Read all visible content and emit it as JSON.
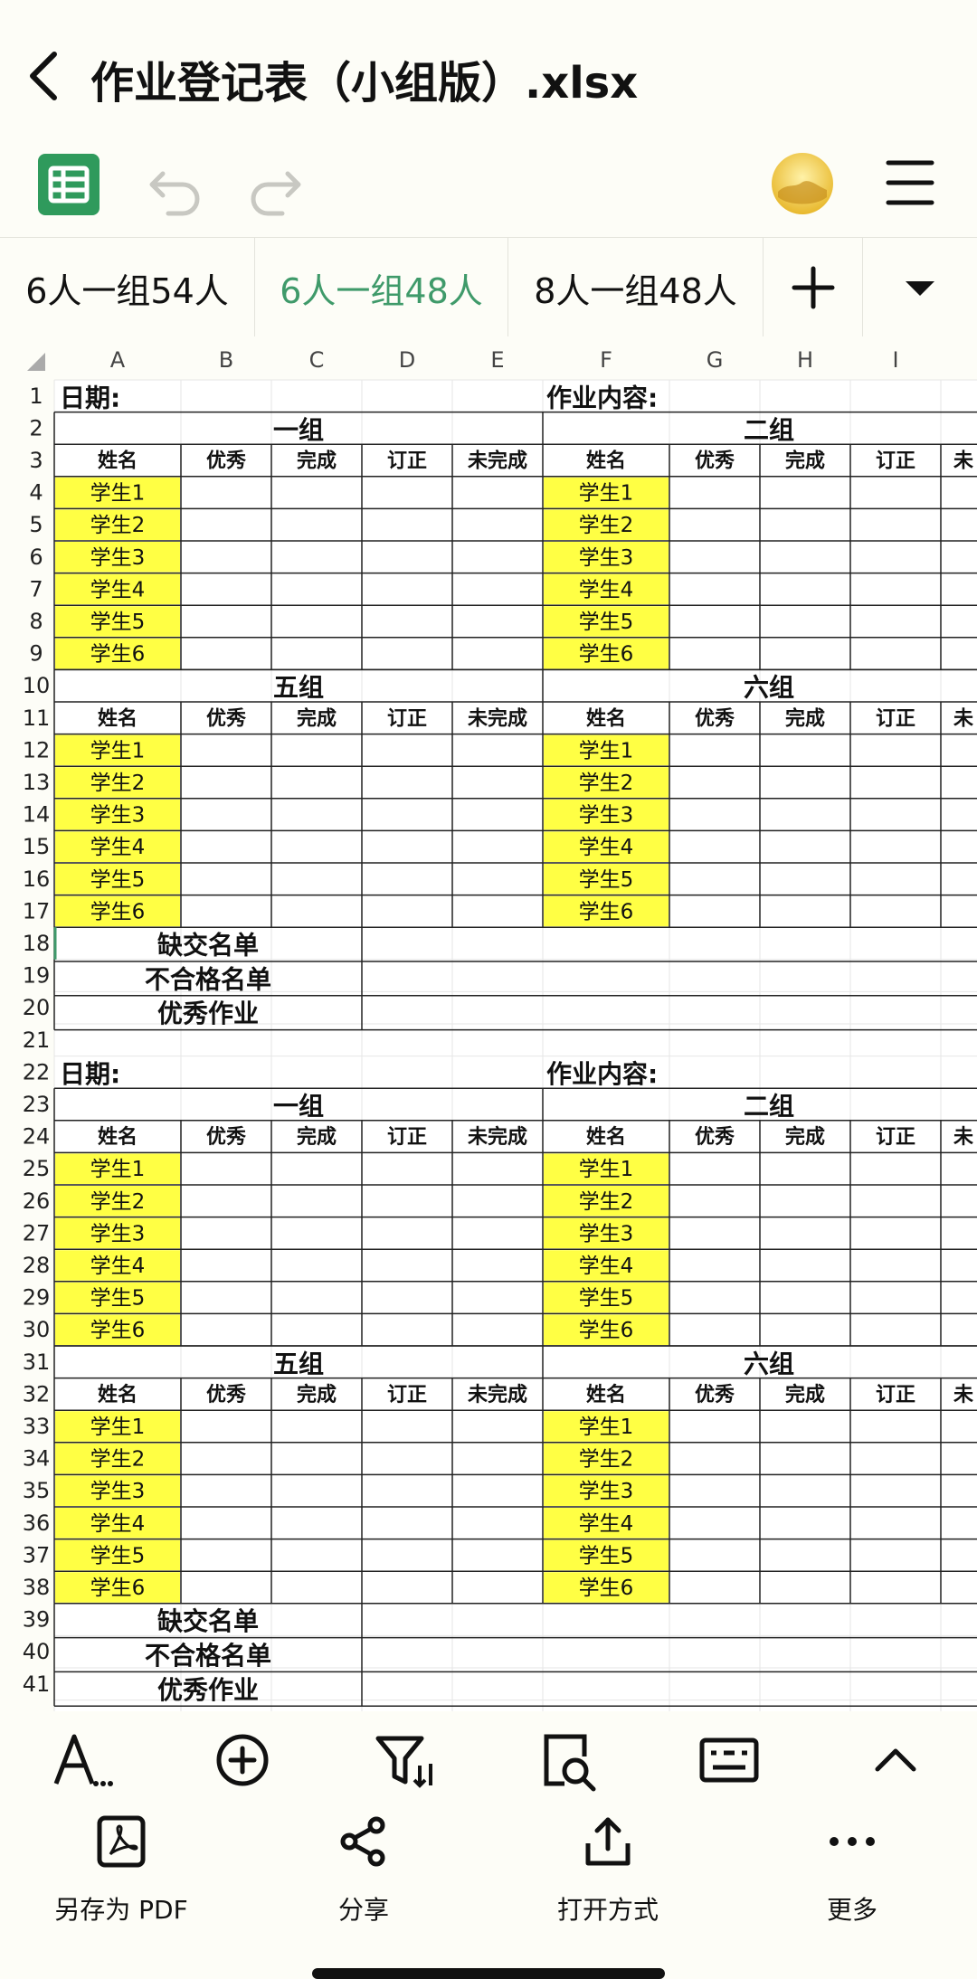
{
  "window": {
    "title": "作业登记表（小组版）.xlsx"
  },
  "toolbar": {
    "icons": [
      "sheets-app-icon",
      "undo-icon",
      "redo-icon",
      "avatar",
      "hamburger-menu-icon"
    ],
    "brand_color": "#2f9a5c"
  },
  "sheet_tabs": {
    "tabs": [
      "6人一组54人",
      "6人一组48人",
      "8人一组48人"
    ],
    "active_index": 1,
    "active_color": "#3f9a6a",
    "add_icon": "plus-icon",
    "more_icon": "caret-down-icon"
  },
  "spreadsheet": {
    "columns": [
      "A",
      "B",
      "C",
      "D",
      "E",
      "F",
      "G",
      "H",
      "I"
    ],
    "rows": [
      "1",
      "2",
      "3",
      "4",
      "5",
      "6",
      "7",
      "8",
      "9",
      "10",
      "11",
      "12",
      "13",
      "14",
      "15",
      "16",
      "17",
      "18",
      "19",
      "20",
      "21",
      "22",
      "23",
      "24",
      "25",
      "26",
      "27",
      "28",
      "29",
      "30",
      "31",
      "32",
      "33",
      "34",
      "35",
      "36",
      "37",
      "38",
      "39",
      "40",
      "41"
    ],
    "date_label": "日期:",
    "content_label": "作业内容:",
    "group_one": "一组",
    "group_two": "二组",
    "group_five": "五组",
    "group_six": "六组",
    "headers": [
      "姓名",
      "优秀",
      "完成",
      "订正",
      "未完成"
    ],
    "cut_header": "未",
    "students": [
      "学生1",
      "学生2",
      "学生3",
      "学生4",
      "学生5",
      "学生6"
    ],
    "missing_list": "缺交名单",
    "failed_list": "不合格名单",
    "excellent_work": "优秀作业",
    "student_fill": "#ffff44"
  },
  "bottom_tools": {
    "icons": [
      "text-format-icon",
      "insert-plus-icon",
      "filter-sort-icon",
      "find-icon",
      "keyboard-icon",
      "chevron-up-icon"
    ]
  },
  "bottom_actions": {
    "save_pdf": "另存为 PDF",
    "share": "分享",
    "open_with": "打开方式",
    "more": "更多"
  }
}
